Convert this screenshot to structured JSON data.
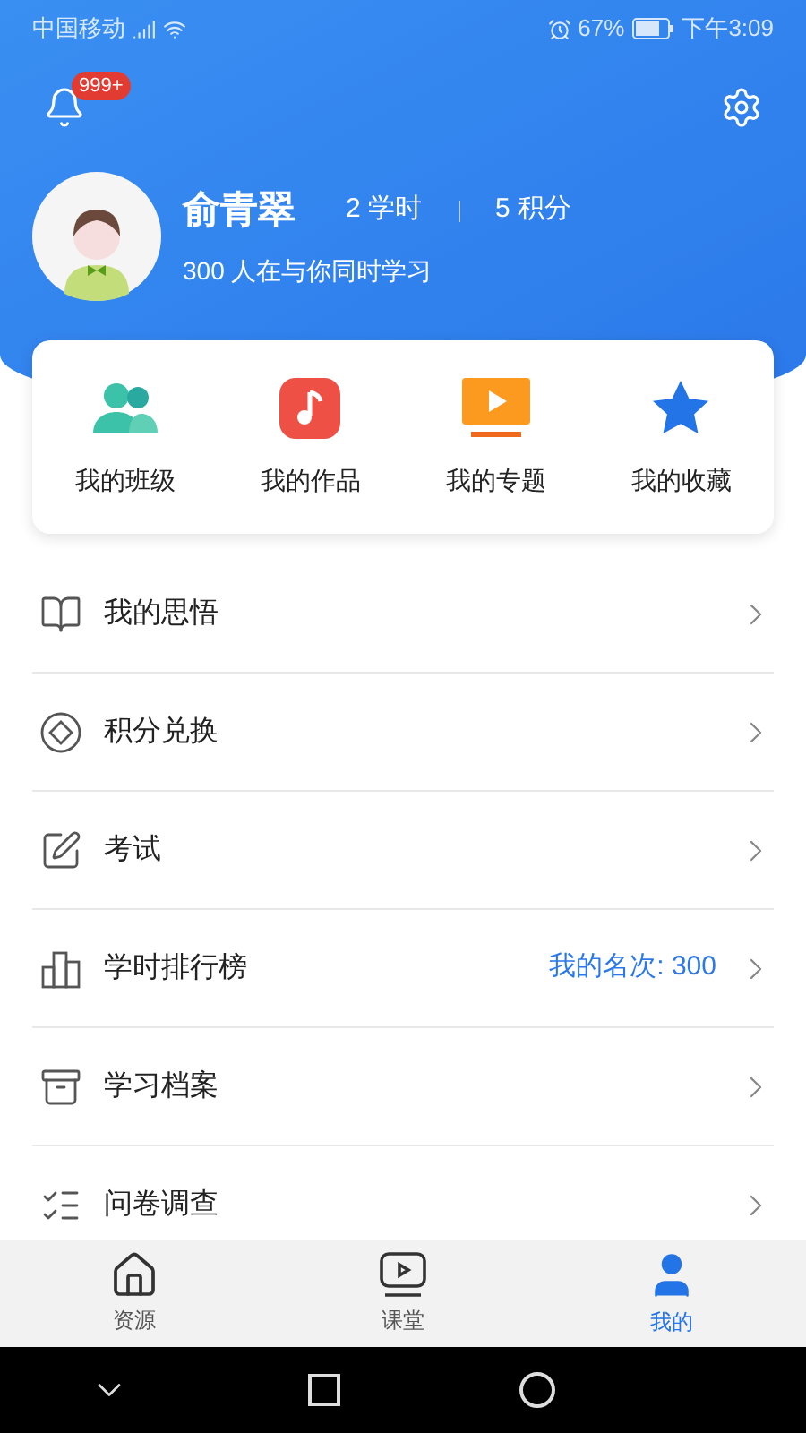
{
  "status_bar": {
    "carrier": "中国移动",
    "battery": "67%",
    "time": "下午3:09"
  },
  "header": {
    "notification_badge": "999+"
  },
  "profile": {
    "name": "俞青翠",
    "hours": "2 学时",
    "points": "5 积分",
    "subtitle": "300 人在与你同时学习"
  },
  "shortcuts": [
    {
      "kind": "class",
      "label": "我的班级"
    },
    {
      "kind": "works",
      "label": "我的作品"
    },
    {
      "kind": "topics",
      "label": "我的专题"
    },
    {
      "kind": "favorites",
      "label": "我的收藏"
    }
  ],
  "menu": [
    {
      "kind": "reflection",
      "label": "我的思悟"
    },
    {
      "kind": "points",
      "label": "积分兑换"
    },
    {
      "kind": "exam",
      "label": "考试"
    },
    {
      "kind": "ranking",
      "label": "学时排行榜",
      "value": "我的名次: 300"
    },
    {
      "kind": "archive",
      "label": "学习档案"
    },
    {
      "kind": "survey",
      "label": "问卷调查"
    }
  ],
  "tabs": [
    {
      "kind": "home",
      "label": "资源",
      "selected": false
    },
    {
      "kind": "class",
      "label": "课堂",
      "selected": false
    },
    {
      "kind": "me",
      "label": "我的",
      "selected": true
    }
  ]
}
